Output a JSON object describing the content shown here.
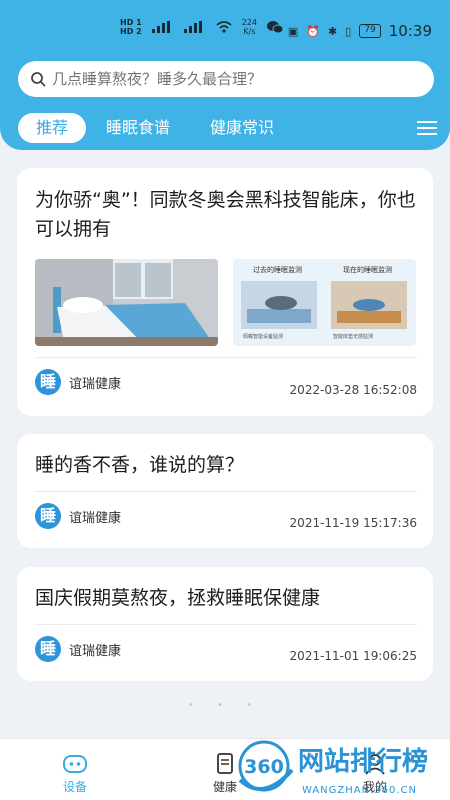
{
  "statusbar": {
    "sim1": "HD 1",
    "sim2": "HD 2",
    "net_speed": "224",
    "net_speed_unit": "K/s",
    "battery": "79",
    "time": "10:39"
  },
  "search": {
    "placeholder": "几点睡算熬夜？睡多久最合理？"
  },
  "tabs": [
    {
      "label": "推荐"
    },
    {
      "label": "睡眠食谱"
    },
    {
      "label": "健康常识"
    }
  ],
  "colors": {
    "header_blue": "#3fb3e6",
    "accent": "#36aee3",
    "background": "#eef1f5"
  },
  "articles": [
    {
      "title": "为你骄“奥”！同款冬奥会黑科技智能床，你也可以拥有",
      "thumb_left_caption": "过去的睡眠监测",
      "thumb_right_caption": "现在的睡眠监测",
      "thumb_left_note": "佩戴智能设备监测",
      "thumb_right_note": "智能床垫无感监测",
      "source": "谊瑞健康",
      "source_logo": "睡",
      "date": "2022-03-28 16:52:08"
    },
    {
      "title": "睡的香不香，谁说的算？",
      "source": "谊瑞健康",
      "source_logo": "睡",
      "date": "2021-11-19 15:17:36"
    },
    {
      "title": "国庆假期莫熬夜，拯救睡眠保健康",
      "source": "谊瑞健康",
      "source_logo": "睡",
      "date": "2021-11-01 19:06:25"
    }
  ],
  "bottomnav": [
    {
      "label": "设备"
    },
    {
      "label": "健康"
    },
    {
      "label": "我的"
    }
  ],
  "watermark": {
    "badge": "360",
    "text": "网站排行榜",
    "url": "WANGZHAN.360.CN"
  }
}
